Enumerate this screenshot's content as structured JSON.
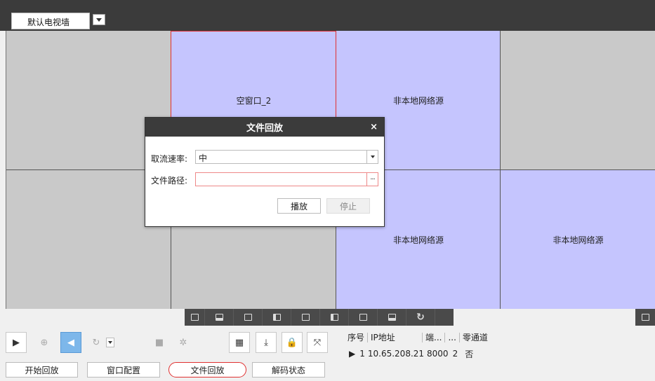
{
  "wall": {
    "selected": "默认电视墙"
  },
  "cells": {
    "r0c1": "空窗口_2",
    "r0c2": "非本地网络源",
    "r1c2": "非本地网络源",
    "r1c3": "非本地网络源"
  },
  "dialog": {
    "title": "文件回放",
    "close": "×",
    "rate_label": "取流速率:",
    "rate_value": "中",
    "path_label": "文件路径:",
    "path_value": "",
    "browse": "···",
    "play": "播放",
    "stop": "停止"
  },
  "bottom_buttons": {
    "start_playback": "开始回放",
    "window_config": "窗口配置",
    "file_playback": "文件回放",
    "decode_status": "解码状态"
  },
  "table": {
    "headers": [
      "序号",
      "IP地址",
      "端...",
      "...",
      "零通道"
    ],
    "rows": [
      {
        "index": "1",
        "ip": "10.65.208.21",
        "port": "8000",
        "channel": "2",
        "zero": "否"
      }
    ]
  },
  "icons": {
    "play": "play-icon",
    "zoom": "zoom-in-icon",
    "volume": "volume-icon",
    "rotate": "rotate-icon",
    "record": "record-icon",
    "settings": "gear-icon",
    "capture": "capture-icon",
    "download": "download-icon",
    "lock": "lock-icon",
    "fullscreen": "fullscreen-icon",
    "refresh": "refresh-icon"
  },
  "colors": {
    "selected_border": "#e03030",
    "cell_blue": "#c5c5fe",
    "cell_gray": "#c9c9c9",
    "header": "#3b3b3b",
    "active_btn": "#7db7ea"
  }
}
